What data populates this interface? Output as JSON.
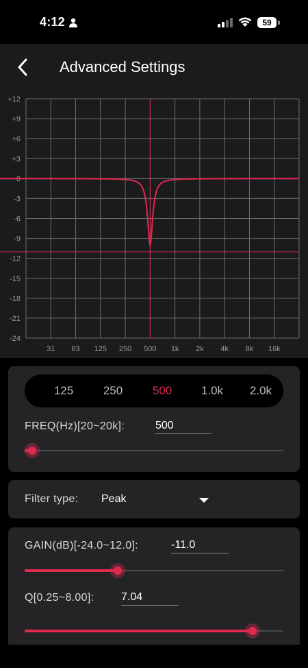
{
  "status": {
    "time": "4:12",
    "battery": "59",
    "icons": [
      "person-icon",
      "signal-icon",
      "wifi-icon",
      "battery-icon"
    ]
  },
  "header": {
    "title": "Advanced Settings",
    "back_icon": "chevron-left-icon"
  },
  "graph": {
    "y_labels": [
      "+12",
      "+9",
      "+6",
      "+3",
      "0",
      "-3",
      "-6",
      "-9",
      "-12",
      "-15",
      "-18",
      "-21",
      "-24"
    ],
    "x_labels": [
      "31",
      "63",
      "125",
      "250",
      "500",
      "1k",
      "2k",
      "4k",
      "8k",
      "16k"
    ],
    "gain_db": -11.0,
    "center_freq_label": "500",
    "accent_color": "#e0294f"
  },
  "presets": {
    "items": [
      "125",
      "250",
      "500",
      "1.0k",
      "2.0k"
    ],
    "active": "500"
  },
  "freq": {
    "label": "FREQ(Hz)[20~20k]:",
    "value": "500",
    "slider_fraction": 0.03
  },
  "filter": {
    "label": "Filter type:",
    "value": "Peak"
  },
  "gain": {
    "label": "GAIN(dB)[-24.0~12.0]:",
    "value": "-11.0",
    "slider_fraction": 0.36
  },
  "q": {
    "label": "Q[0.25~8.00]:",
    "value": "7.04",
    "slider_fraction": 0.88
  },
  "colors": {
    "accent": "#e0294f",
    "background": "#000000",
    "panel": "#1b1b1d",
    "card": "#242426"
  }
}
